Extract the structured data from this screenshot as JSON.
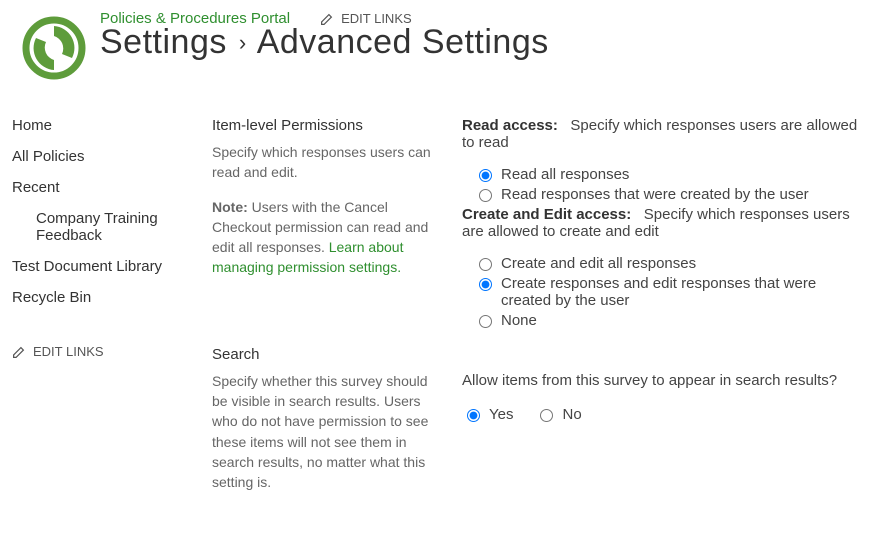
{
  "top": {
    "portal_link": "Policies & Procedures Portal",
    "edit_links": "EDIT LINKS",
    "title_left": "Settings",
    "title_right": "Advanced Settings"
  },
  "nav": {
    "items": [
      {
        "label": "Home"
      },
      {
        "label": "All Policies"
      },
      {
        "label": "Recent"
      },
      {
        "label": "Company Training Feedback",
        "sub": true
      },
      {
        "label": "Test Document Library"
      },
      {
        "label": "Recycle Bin"
      }
    ],
    "edit_links": "EDIT LINKS"
  },
  "sections": {
    "permissions": {
      "heading": "Item-level Permissions",
      "desc1": "Specify which responses users can read and edit.",
      "note_label": "Note:",
      "note_body": " Users with the Cancel Checkout permission can read and edit all responses. ",
      "learn_link": "Learn about managing permission settings.",
      "read_label": "Read access:",
      "read_help": "Specify which responses users are allowed to read",
      "read_opt1": "Read all responses",
      "read_opt2": "Read responses that were created by the user",
      "edit_label": "Create and Edit access:",
      "edit_help": "Specify which responses users are allowed to create and edit",
      "edit_opt1": "Create and edit all responses",
      "edit_opt2": "Create responses and edit responses that were created by the user",
      "edit_opt3": "None"
    },
    "search": {
      "heading": "Search",
      "desc": "Specify whether this survey should be visible in search results. Users who do not have permission to see these items will not see them in search results, no matter what this setting is.",
      "question": "Allow items from this survey to appear in search results?",
      "yes": "Yes",
      "no": "No"
    }
  }
}
